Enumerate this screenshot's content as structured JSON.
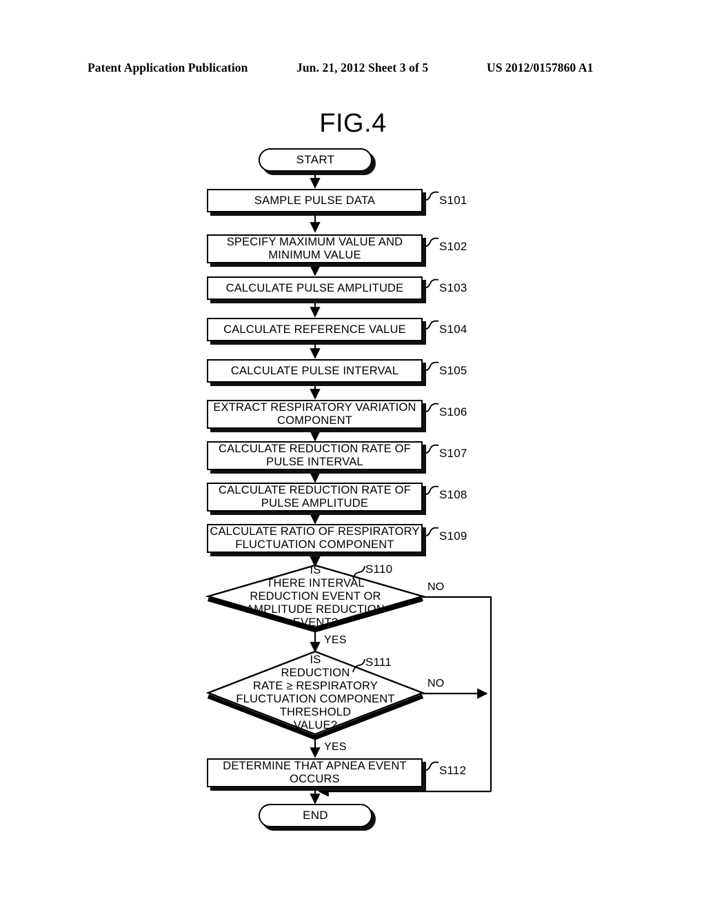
{
  "header": {
    "publication": "Patent Application Publication",
    "date_sheet": "Jun. 21, 2012  Sheet 3 of 5",
    "patent_number": "US 2012/0157860 A1"
  },
  "figure": {
    "title": "FIG.4"
  },
  "flowchart": {
    "start_label": "START",
    "end_label": "END",
    "yes_label": "YES",
    "no_label": "NO",
    "steps": [
      {
        "id": "S101",
        "text_line1": "SAMPLE PULSE DATA",
        "text_line2": ""
      },
      {
        "id": "S102",
        "text_line1": "SPECIFY MAXIMUM VALUE AND",
        "text_line2": "MINIMUM VALUE"
      },
      {
        "id": "S103",
        "text_line1": "CALCULATE PULSE AMPLITUDE",
        "text_line2": ""
      },
      {
        "id": "S104",
        "text_line1": "CALCULATE REFERENCE VALUE",
        "text_line2": ""
      },
      {
        "id": "S105",
        "text_line1": "CALCULATE PULSE INTERVAL",
        "text_line2": ""
      },
      {
        "id": "S106",
        "text_line1": "EXTRACT RESPIRATORY VARIATION",
        "text_line2": "COMPONENT"
      },
      {
        "id": "S107",
        "text_line1": "CALCULATE REDUCTION RATE OF",
        "text_line2": "PULSE INTERVAL"
      },
      {
        "id": "S108",
        "text_line1": "CALCULATE REDUCTION RATE OF",
        "text_line2": "PULSE AMPLITUDE"
      },
      {
        "id": "S109",
        "text_line1": "CALCULATE RATIO OF RESPIRATORY",
        "text_line2": "FLUCTUATION COMPONENT"
      },
      {
        "id": "S112",
        "text_line1": "DETERMINE THAT APNEA EVENT",
        "text_line2": "OCCURS"
      }
    ],
    "decisions": [
      {
        "id": "S110",
        "lines": [
          "IS",
          "THERE INTERVAL",
          "REDUCTION EVENT OR",
          "AMPLITUDE REDUCTION",
          "EVENT?"
        ],
        "yes_label": "YES",
        "no_label": "NO"
      },
      {
        "id": "S111",
        "lines": [
          "IS",
          "REDUCTION",
          "RATE ≥ RESPIRATORY",
          "FLUCTUATION COMPONENT",
          "THRESHOLD",
          "VALUE?"
        ],
        "yes_label": "YES",
        "no_label": "NO"
      }
    ]
  },
  "colors": {
    "ink": "#000000",
    "paper": "#ffffff",
    "shadow": "#111111"
  }
}
